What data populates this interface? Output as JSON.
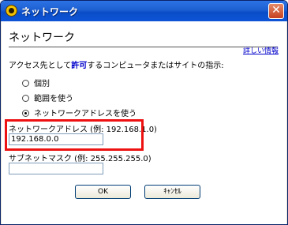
{
  "window": {
    "title": "ネットワーク",
    "close_glyph": "✕"
  },
  "page": {
    "heading": "ネットワーク",
    "details_link": "詳しい情報",
    "instruction": {
      "prefix": "アクセス先として",
      "highlight": "許可",
      "suffix": "するコンピュータまたはサイトの指示:"
    },
    "radios": [
      {
        "label": "個別",
        "selected": false
      },
      {
        "label": "範囲を使う",
        "selected": false
      },
      {
        "label": "ネットワークアドレスを使う",
        "selected": true
      }
    ],
    "network_address": {
      "label": "ネットワークアドレス (例: 192.168.1.0)",
      "value": "192.168.0.0"
    },
    "subnet_mask": {
      "label": "サブネットマスク (例: 255.255.255.0)",
      "value": ""
    },
    "buttons": {
      "ok": "OK",
      "cancel": "ｷｬﾝｾﾙ"
    }
  },
  "colors": {
    "highlight_border": "#ee1111",
    "link": "#0000cc",
    "titlebar": "#0a4dc7"
  }
}
